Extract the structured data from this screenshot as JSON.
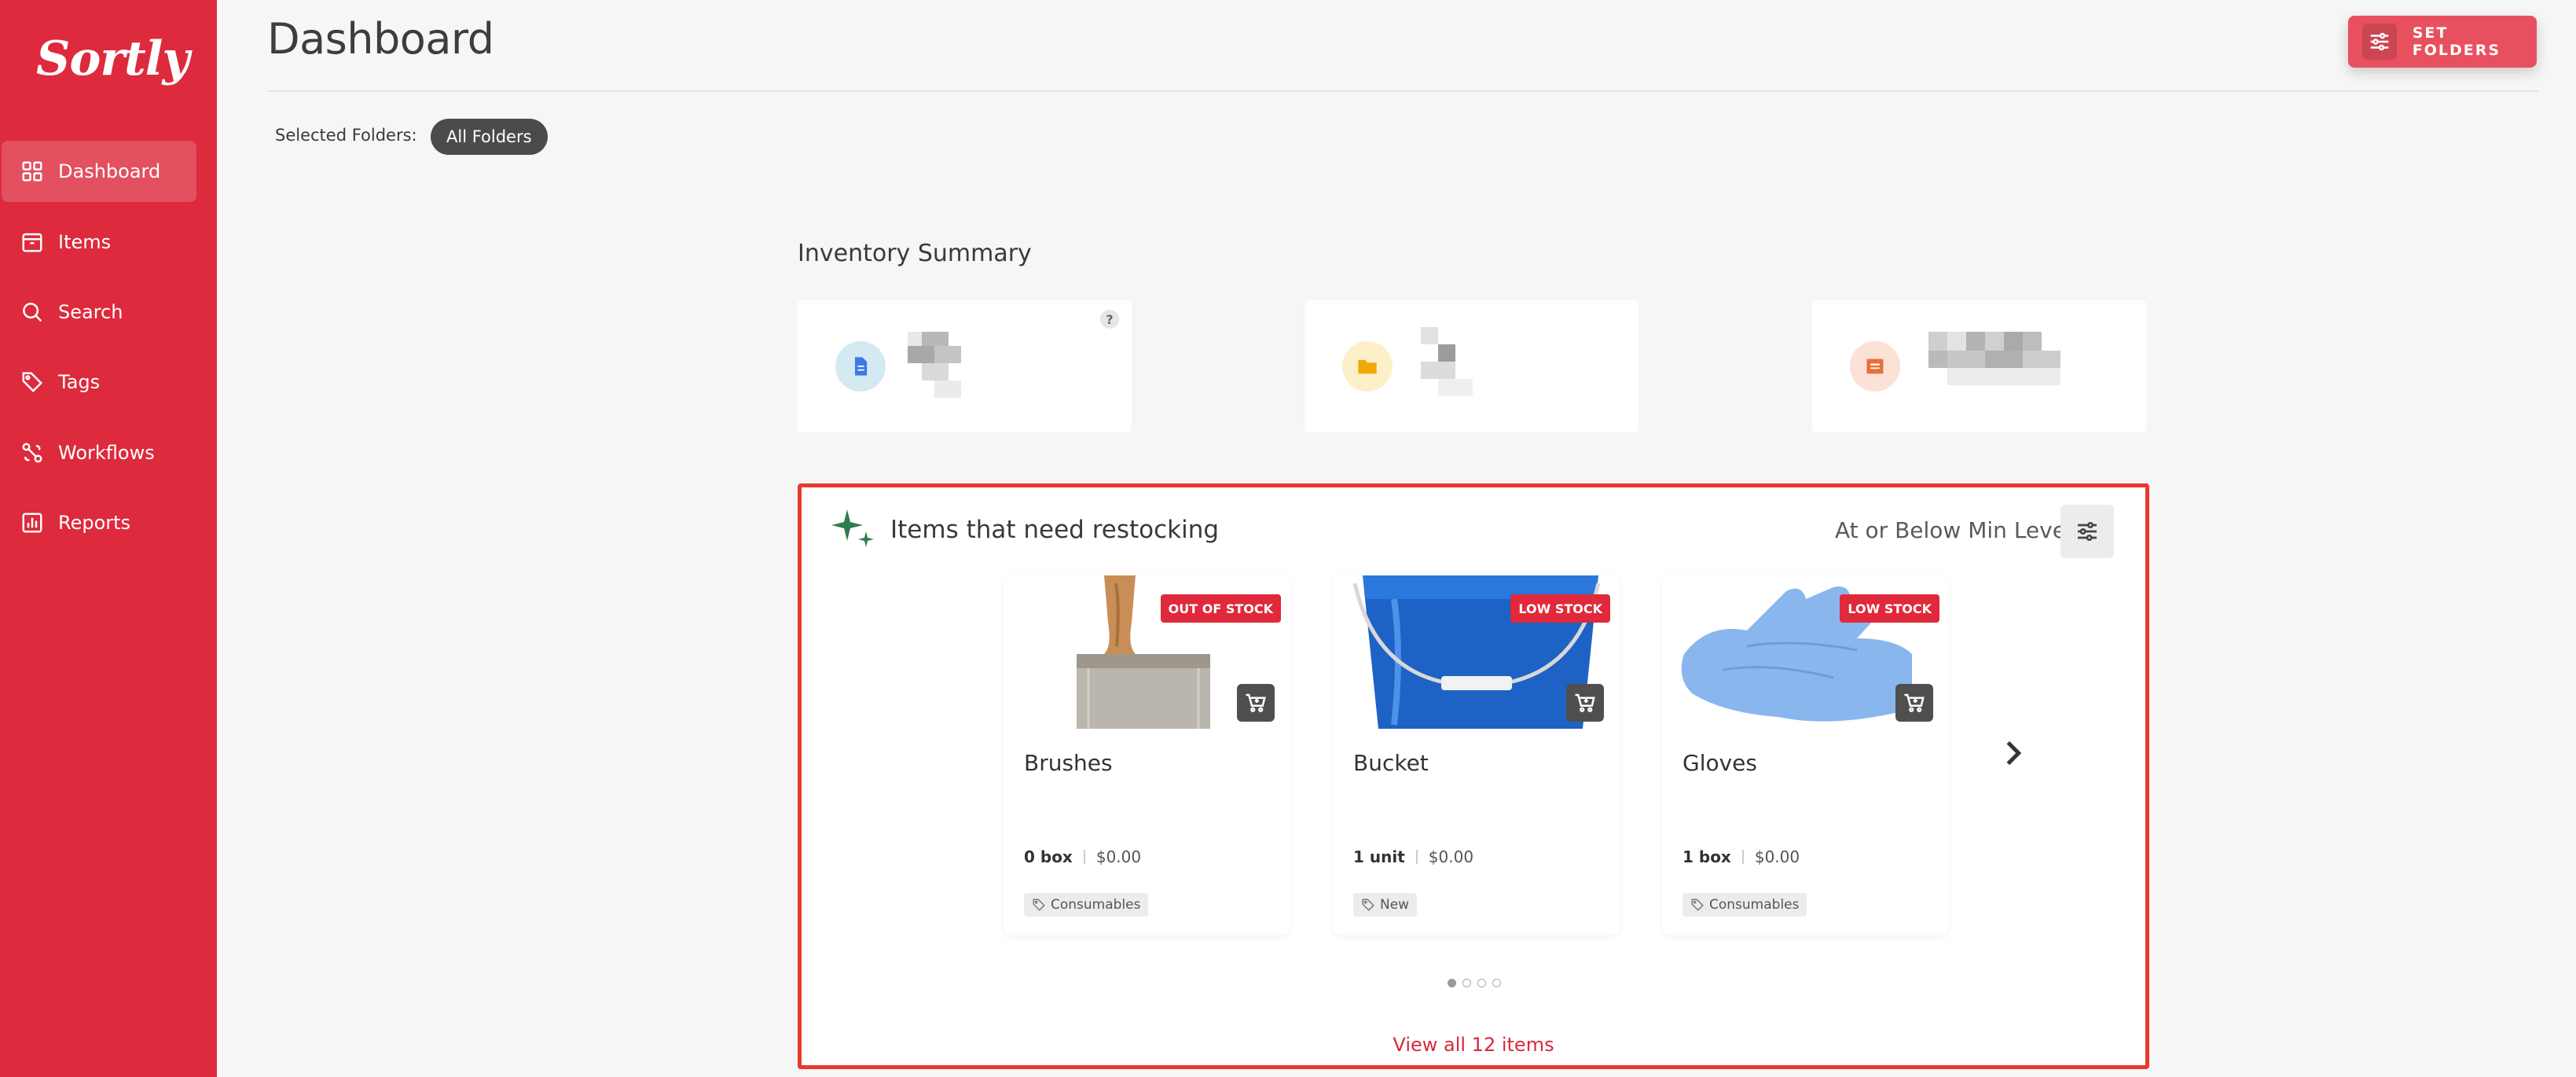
{
  "app": {
    "logo": "Sortly"
  },
  "sidebar": {
    "items": [
      {
        "label": "Dashboard",
        "icon": "dashboard-icon",
        "active": true
      },
      {
        "label": "Items",
        "icon": "items-icon"
      },
      {
        "label": "Search",
        "icon": "search-icon"
      },
      {
        "label": "Tags",
        "icon": "tag-icon"
      },
      {
        "label": "Workflows",
        "icon": "workflows-icon"
      },
      {
        "label": "Reports",
        "icon": "reports-icon"
      }
    ]
  },
  "header": {
    "title": "Dashboard",
    "set_folders_label": "SET FOLDERS",
    "selected_folders_label": "Selected Folders:",
    "selected_folder": "All Folders"
  },
  "inventory_summary": {
    "title": "Inventory Summary",
    "help": "?",
    "cards": [
      {
        "icon": "document-icon",
        "color": "#3b7be0",
        "bg": "#d3eaf2"
      },
      {
        "icon": "folder-icon",
        "color": "#f2a80b",
        "bg": "#fcf0c9"
      },
      {
        "icon": "box-icon",
        "color": "#e8703a",
        "bg": "#fbe1d6"
      }
    ]
  },
  "restock": {
    "title": "Items that need restocking",
    "filter_label": "At or Below Min Level",
    "view_all": "View all 12 items",
    "pages": 4,
    "current_page": 1,
    "items": [
      {
        "name": "Brushes",
        "badge": "OUT OF STOCK",
        "qty": "0 box",
        "price": "$0.00",
        "tag": "Consumables"
      },
      {
        "name": "Bucket",
        "badge": "LOW STOCK",
        "qty": "1 unit",
        "price": "$0.00",
        "tag": "New"
      },
      {
        "name": "Gloves",
        "badge": "LOW STOCK",
        "qty": "1 box",
        "price": "$0.00",
        "tag": "Consumables"
      }
    ]
  },
  "colors": {
    "brand": "#dd2a3d",
    "accent_border": "#e53a2d",
    "badge": "#e0293a"
  }
}
